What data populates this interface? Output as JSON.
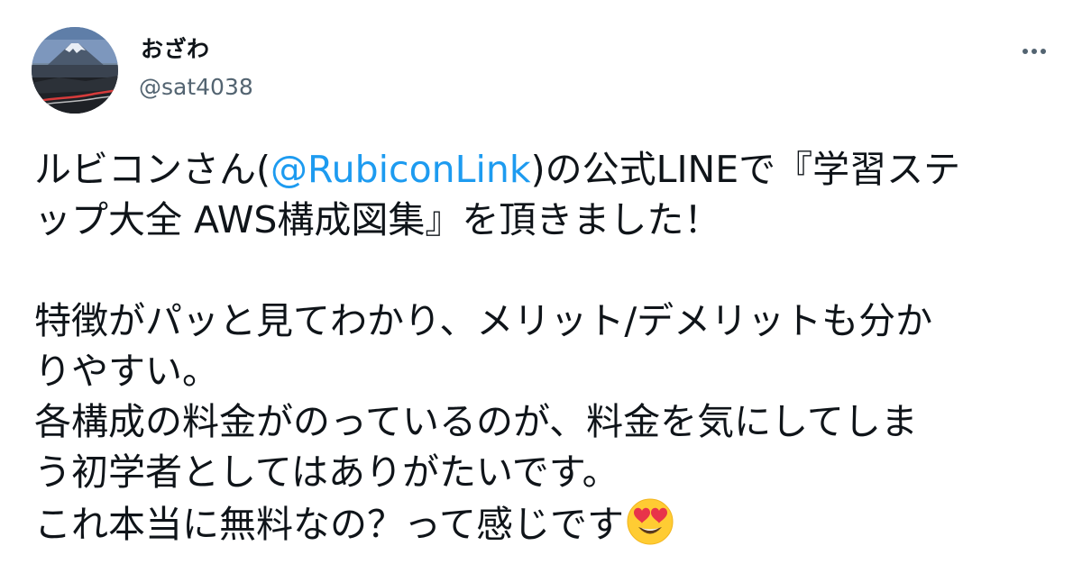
{
  "user": {
    "display_name": "おざわ",
    "handle": "@sat4038"
  },
  "tweet": {
    "line1_pre": "ルビコンさん(",
    "mention": "@RubiconLink",
    "line1_post": ")の公式LINEで『学習ステ",
    "line2": "ップ大全 AWS構成図集』を頂きました！",
    "line3": "特徴がパッと見てわかり、メリット/デメリットも分か",
    "line4": "りやすい。",
    "line5": "各構成の料金がのっているのが、料金を気にしてしま",
    "line6": "う初学者としてはありがたいです。",
    "line7": "これ本当に無料なの？って感じです",
    "emoji": "smiling-face-with-heart-eyes"
  },
  "colors": {
    "text": "#0f1419",
    "secondary": "#536471",
    "link": "#1d9bf0"
  },
  "icons": {
    "more": "more-horizontal-icon"
  }
}
